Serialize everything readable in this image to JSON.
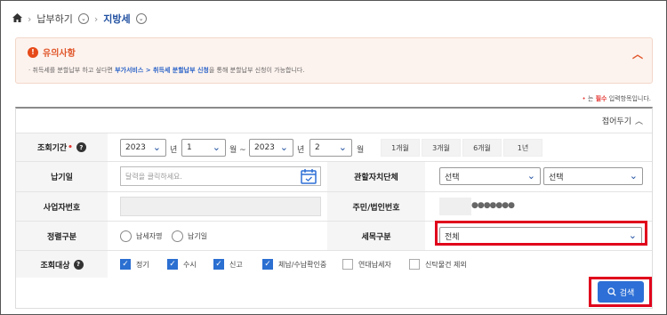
{
  "breadcrumb": {
    "level1": "납부하기",
    "level2": "지방세"
  },
  "notice": {
    "title": "유의사항",
    "text_prefix": "· 취득세를 분할납부 하고 싶다면 ",
    "text_link": "부가서비스 > 취득세 분할납부 신청",
    "text_suffix": "을 통해 분할납부 신청이 가능합니다."
  },
  "required_note": {
    "prefix": "는 ",
    "emph": "필수",
    "suffix": " 입력항목입니다."
  },
  "panel": {
    "collapse_label": "접어두기"
  },
  "period": {
    "label": "조회기간",
    "from_year": "2023",
    "year_unit": "년",
    "from_month": "1",
    "month_unit_sep": "월 ~",
    "to_year": "2023",
    "to_month": "2",
    "month_unit": "월",
    "presets": [
      "1개월",
      "3개월",
      "6개월",
      "1년"
    ]
  },
  "payment_date": {
    "label": "납기일",
    "placeholder": "달력을 클릭하세요."
  },
  "jurisdiction": {
    "label": "관할자치단체",
    "select1": "선택",
    "select2": "선택"
  },
  "business_no": {
    "label": "사업자번호"
  },
  "resident_no": {
    "label": "주민/법인번호",
    "value": "●●●●●●●"
  },
  "payment_type": {
    "label": "정렬구분",
    "options": [
      "납세자명",
      "납기일"
    ]
  },
  "tax_category": {
    "label": "세목구분",
    "value": "전체"
  },
  "query_target": {
    "label": "조회대상",
    "checks": [
      {
        "label": "정기",
        "checked": true
      },
      {
        "label": "수시",
        "checked": true
      },
      {
        "label": "신고",
        "checked": true
      },
      {
        "label": "체납/수납확인중",
        "checked": true
      },
      {
        "label": "연대납세자",
        "checked": false
      },
      {
        "label": "신탁물건 제외",
        "checked": false
      }
    ]
  },
  "search_button": {
    "label": "검색"
  },
  "colors": {
    "accent": "#2d6fd6",
    "highlight": "#e0001b",
    "notice": "#e0562a"
  }
}
